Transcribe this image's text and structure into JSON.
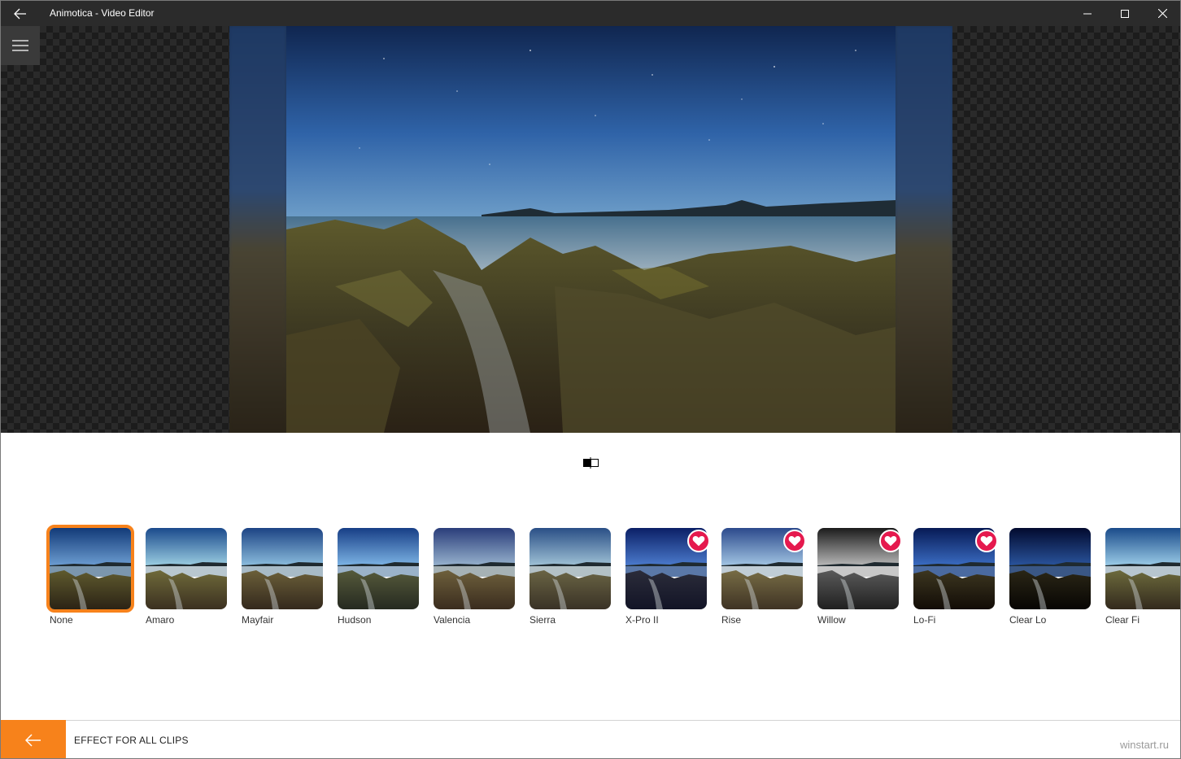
{
  "window": {
    "title": "Animotica - Video Editor"
  },
  "titlebar": {
    "back_icon": "back-arrow-icon",
    "minimize_icon": "minimize-icon",
    "maximize_icon": "maximize-icon",
    "close_icon": "close-icon"
  },
  "preview": {
    "menu_icon": "hamburger-menu-icon",
    "compare_icon": "before-after-compare-icon"
  },
  "filters": [
    {
      "label": "None",
      "selected": true,
      "favorite": false,
      "tone": "none"
    },
    {
      "label": "Amaro",
      "selected": false,
      "favorite": false,
      "tone": "amaro"
    },
    {
      "label": "Mayfair",
      "selected": false,
      "favorite": false,
      "tone": "mayfair"
    },
    {
      "label": "Hudson",
      "selected": false,
      "favorite": false,
      "tone": "hudson"
    },
    {
      "label": "Valencia",
      "selected": false,
      "favorite": false,
      "tone": "valencia"
    },
    {
      "label": "Sierra",
      "selected": false,
      "favorite": false,
      "tone": "sierra"
    },
    {
      "label": "X-Pro II",
      "selected": false,
      "favorite": true,
      "tone": "xpro"
    },
    {
      "label": "Rise",
      "selected": false,
      "favorite": true,
      "tone": "rise"
    },
    {
      "label": "Willow",
      "selected": false,
      "favorite": true,
      "tone": "willow"
    },
    {
      "label": "Lo-Fi",
      "selected": false,
      "favorite": true,
      "tone": "lofi"
    },
    {
      "label": "Clear Lo",
      "selected": false,
      "favorite": false,
      "tone": "clearlo"
    },
    {
      "label": "Clear Fi",
      "selected": false,
      "favorite": false,
      "tone": "clearfi"
    }
  ],
  "bottombar": {
    "back_icon": "back-arrow-icon",
    "label": "EFFECT FOR ALL CLIPS",
    "watermark": "winstart.ru"
  },
  "colors": {
    "accent": "#f7821b",
    "favorite": "#e5194e",
    "titlebar": "#2b2b2b"
  }
}
